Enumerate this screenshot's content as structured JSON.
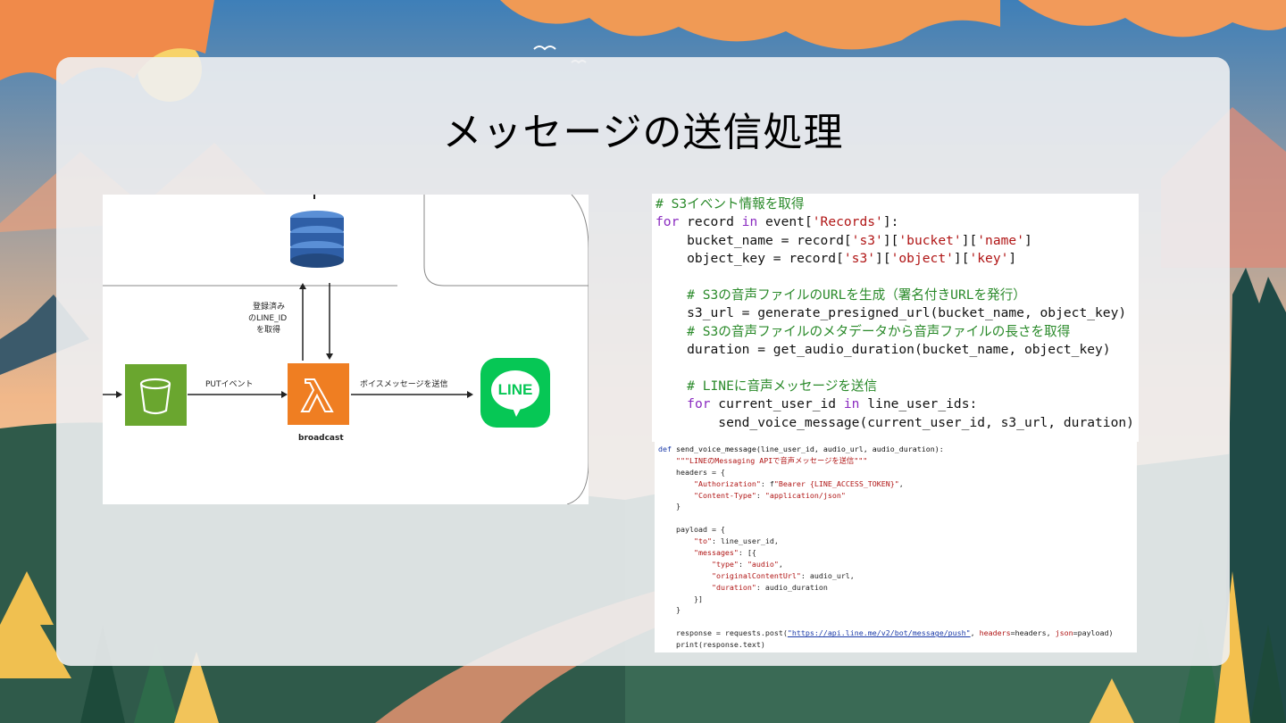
{
  "slide": {
    "title": "メッセージの送信処理"
  },
  "diagram": {
    "label_registered": "登録済み",
    "label_of_line_id": "のLINE_ID",
    "label_get": "を取得",
    "label_put_event": "PUTイベント",
    "label_voice_send": "ボイスメッセージを送信",
    "label_broadcast": "broadcast",
    "line_logo_text": "LINE",
    "icons": [
      "dynamodb-icon",
      "s3-bucket-icon",
      "lambda-icon",
      "line-logo"
    ],
    "colors": {
      "s3": "#6aa62f",
      "lambda": "#ef7e22",
      "dynamo": "#2f5fa7",
      "line": "#06c755"
    }
  },
  "code_main": {
    "lines": [
      {
        "seg": [
          {
            "c": "cm",
            "t": "# S3イベント情報を取得"
          }
        ]
      },
      {
        "seg": [
          {
            "c": "kw",
            "t": "for"
          },
          {
            "c": "",
            "t": " record "
          },
          {
            "c": "kw",
            "t": "in"
          },
          {
            "c": "",
            "t": " event["
          },
          {
            "c": "st",
            "t": "'Records'"
          },
          {
            "c": "",
            "t": "]:"
          }
        ]
      },
      {
        "seg": [
          {
            "c": "",
            "t": "    bucket_name = record["
          },
          {
            "c": "st",
            "t": "'s3'"
          },
          {
            "c": "",
            "t": "]["
          },
          {
            "c": "st",
            "t": "'bucket'"
          },
          {
            "c": "",
            "t": "]["
          },
          {
            "c": "st",
            "t": "'name'"
          },
          {
            "c": "",
            "t": "]"
          }
        ]
      },
      {
        "seg": [
          {
            "c": "",
            "t": "    object_key = record["
          },
          {
            "c": "st",
            "t": "'s3'"
          },
          {
            "c": "",
            "t": "]["
          },
          {
            "c": "st",
            "t": "'object'"
          },
          {
            "c": "",
            "t": "]["
          },
          {
            "c": "st",
            "t": "'key'"
          },
          {
            "c": "",
            "t": "]"
          }
        ]
      },
      {
        "seg": [
          {
            "c": "",
            "t": ""
          }
        ]
      },
      {
        "seg": [
          {
            "c": "",
            "t": "    "
          },
          {
            "c": "cm",
            "t": "# S3の音声ファイルのURLを生成（署名付きURLを発行）"
          }
        ]
      },
      {
        "seg": [
          {
            "c": "",
            "t": "    s3_url = generate_presigned_url(bucket_name, object_key)"
          }
        ]
      },
      {
        "seg": [
          {
            "c": "",
            "t": "    "
          },
          {
            "c": "cm",
            "t": "# S3の音声ファイルのメタデータから音声ファイルの長さを取得"
          }
        ]
      },
      {
        "seg": [
          {
            "c": "",
            "t": "    duration = get_audio_duration(bucket_name, object_key)"
          }
        ]
      },
      {
        "seg": [
          {
            "c": "",
            "t": ""
          }
        ]
      },
      {
        "seg": [
          {
            "c": "",
            "t": "    "
          },
          {
            "c": "cm",
            "t": "# LINEに音声メッセージを送信"
          }
        ]
      },
      {
        "seg": [
          {
            "c": "",
            "t": "    "
          },
          {
            "c": "kw",
            "t": "for"
          },
          {
            "c": "",
            "t": " current_user_id "
          },
          {
            "c": "kw",
            "t": "in"
          },
          {
            "c": "",
            "t": " line_user_ids:"
          }
        ]
      },
      {
        "seg": [
          {
            "c": "",
            "t": "        send_voice_message(current_user_id, s3_url, duration)"
          }
        ]
      }
    ]
  },
  "code_func": {
    "lines": [
      {
        "seg": [
          {
            "c": "bl",
            "t": "def"
          },
          {
            "c": "fn",
            "t": " send_voice_message(line_user_id, audio_url, audio_duration):"
          }
        ]
      },
      {
        "seg": [
          {
            "c": "",
            "t": "    "
          },
          {
            "c": "st",
            "t": "\"\"\"LINEのMessaging APIで音声メッセージを送信\"\"\""
          }
        ]
      },
      {
        "seg": [
          {
            "c": "",
            "t": "    headers = {"
          }
        ]
      },
      {
        "seg": [
          {
            "c": "",
            "t": "        "
          },
          {
            "c": "st",
            "t": "\"Authorization\""
          },
          {
            "c": "",
            "t": ": f"
          },
          {
            "c": "st",
            "t": "\"Bearer {LINE_ACCESS_TOKEN}\""
          },
          {
            "c": "",
            "t": ","
          }
        ]
      },
      {
        "seg": [
          {
            "c": "",
            "t": "        "
          },
          {
            "c": "st",
            "t": "\"Content-Type\""
          },
          {
            "c": "",
            "t": ": "
          },
          {
            "c": "st",
            "t": "\"application/json\""
          }
        ]
      },
      {
        "seg": [
          {
            "c": "",
            "t": "    }"
          }
        ]
      },
      {
        "seg": [
          {
            "c": "",
            "t": ""
          }
        ]
      },
      {
        "seg": [
          {
            "c": "",
            "t": "    payload = {"
          }
        ]
      },
      {
        "seg": [
          {
            "c": "",
            "t": "        "
          },
          {
            "c": "st",
            "t": "\"to\""
          },
          {
            "c": "",
            "t": ": line_user_id,"
          }
        ]
      },
      {
        "seg": [
          {
            "c": "",
            "t": "        "
          },
          {
            "c": "st",
            "t": "\"messages\""
          },
          {
            "c": "",
            "t": ": [{"
          }
        ]
      },
      {
        "seg": [
          {
            "c": "",
            "t": "            "
          },
          {
            "c": "st",
            "t": "\"type\""
          },
          {
            "c": "",
            "t": ": "
          },
          {
            "c": "st",
            "t": "\"audio\""
          },
          {
            "c": "",
            "t": ","
          }
        ]
      },
      {
        "seg": [
          {
            "c": "",
            "t": "            "
          },
          {
            "c": "st",
            "t": "\"originalContentUrl\""
          },
          {
            "c": "",
            "t": ": audio_url,"
          }
        ]
      },
      {
        "seg": [
          {
            "c": "",
            "t": "            "
          },
          {
            "c": "st",
            "t": "\"duration\""
          },
          {
            "c": "",
            "t": ": audio_duration"
          }
        ]
      },
      {
        "seg": [
          {
            "c": "",
            "t": "        }]"
          }
        ]
      },
      {
        "seg": [
          {
            "c": "",
            "t": "    }"
          }
        ]
      },
      {
        "seg": [
          {
            "c": "",
            "t": ""
          }
        ]
      },
      {
        "seg": [
          {
            "c": "",
            "t": "    response = requests.post("
          },
          {
            "c": "url",
            "t": "\"https://api.line.me/v2/bot/message/push\""
          },
          {
            "c": "",
            "t": ", "
          },
          {
            "c": "st",
            "t": "headers"
          },
          {
            "c": "",
            "t": "=headers, "
          },
          {
            "c": "st",
            "t": "json"
          },
          {
            "c": "",
            "t": "=payload)"
          }
        ]
      },
      {
        "seg": [
          {
            "c": "",
            "t": "    print(response.text)"
          }
        ]
      }
    ]
  }
}
